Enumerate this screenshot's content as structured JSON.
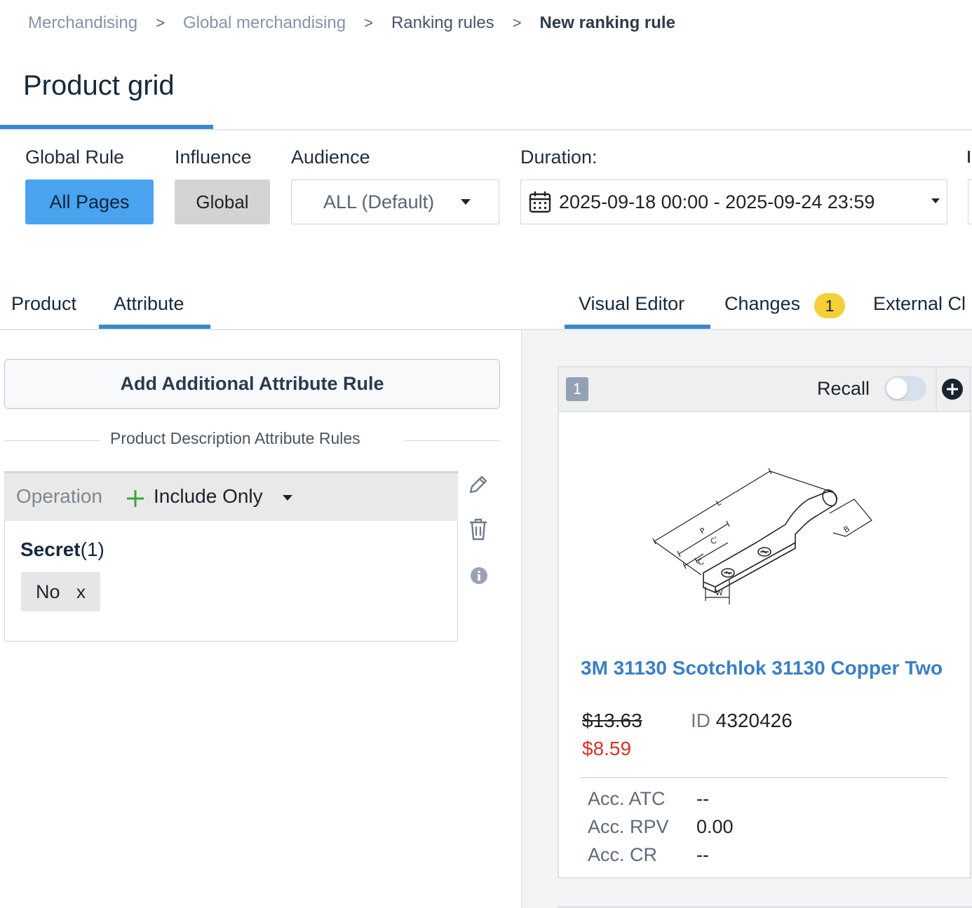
{
  "breadcrumb": {
    "items": [
      "Merchandising",
      "Global merchandising",
      "Ranking rules",
      "New ranking rule"
    ],
    "separator": ">"
  },
  "page": {
    "title": "Product grid"
  },
  "filters": {
    "global_rule_label": "Global Rule",
    "global_rule_value": "All Pages",
    "influence_label": "Influence",
    "influence_value": "Global",
    "audience_label": "Audience",
    "audience_value": "ALL (Default)",
    "duration_label": "Duration:",
    "duration_value": "2025-09-18 00:00 - 2025-09-24 23:59"
  },
  "left_tabs": [
    {
      "label": "Product",
      "active": false
    },
    {
      "label": "Attribute",
      "active": true
    }
  ],
  "right_tabs": [
    {
      "label": "Visual Editor",
      "active": true
    },
    {
      "label": "Changes",
      "badge": "1",
      "active": false
    },
    {
      "label": "External Cl",
      "active": false
    }
  ],
  "attribute_panel": {
    "add_button": "Add Additional Attribute Rule",
    "section_title": "Product Description Attribute Rules",
    "rule": {
      "operation_label": "Operation",
      "operation_value": "Include Only",
      "attribute_name": "Secret",
      "attribute_count": "(1)",
      "chips": [
        {
          "value": "No",
          "remove": "x"
        }
      ]
    }
  },
  "product_card": {
    "position": "1",
    "recall_label": "Recall",
    "recall_on": false,
    "name": "3M 31130 Scotchlok 31130 Copper Two",
    "price_original": "$13.63",
    "price_sale": "$8.59",
    "id_label": "ID",
    "id_value": "4320426",
    "metrics": [
      {
        "label": "Acc. ATC",
        "value": "--"
      },
      {
        "label": "Acc. RPV",
        "value": "0.00"
      },
      {
        "label": "Acc. CR",
        "value": "--"
      }
    ]
  },
  "colors": {
    "accent": "#3a87c9",
    "primary_button": "#4aa3ef",
    "badge": "#f5cf38",
    "product_link": "#3a7fc6",
    "sale_price": "#d6342a",
    "include_plus": "#3aa53a"
  },
  "icons": [
    "chevron-right-icon",
    "calendar-icon",
    "caret-down-icon",
    "plus-icon",
    "pencil-icon",
    "trash-icon",
    "info-icon",
    "add-circle-icon"
  ]
}
